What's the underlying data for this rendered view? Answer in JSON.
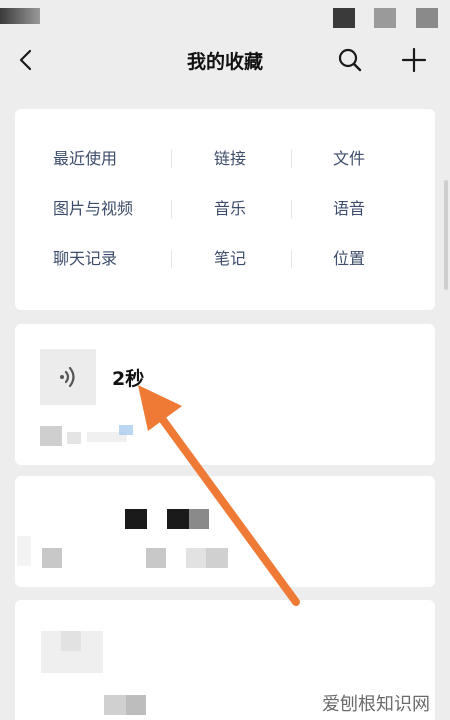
{
  "header": {
    "title": "我的收藏"
  },
  "categories": {
    "row1": [
      "最近使用",
      "链接",
      "文件"
    ],
    "row2": [
      "图片与视频",
      "音乐",
      "语音"
    ],
    "row3": [
      "聊天记录",
      "笔记",
      "位置"
    ]
  },
  "voice_item": {
    "duration": "2秒"
  },
  "watermark": "爱刨根知识网",
  "colors": {
    "category_text": "#3d4d6b",
    "arrow": "#ee7a35",
    "background": "#ededed"
  }
}
